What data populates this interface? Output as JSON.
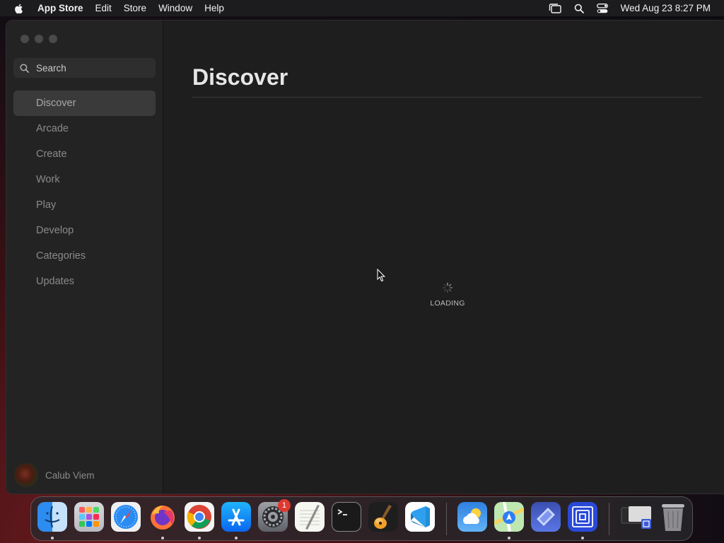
{
  "menubar": {
    "app_name": "App Store",
    "menus": [
      "Edit",
      "Store",
      "Window",
      "Help"
    ],
    "clock": "Wed Aug 23  8:27 PM"
  },
  "sidebar": {
    "search_placeholder": "Search",
    "items": [
      {
        "label": "Discover",
        "active": true
      },
      {
        "label": "Arcade"
      },
      {
        "label": "Create"
      },
      {
        "label": "Work"
      },
      {
        "label": "Play"
      },
      {
        "label": "Develop"
      },
      {
        "label": "Categories"
      },
      {
        "label": "Updates"
      }
    ],
    "user_name": "Calub Viem"
  },
  "main": {
    "title": "Discover",
    "loading_text": "LOADING"
  },
  "dock": {
    "apps": [
      {
        "name": "Finder",
        "icon": "finder-icon",
        "running": true
      },
      {
        "name": "Launchpad",
        "icon": "launchpad-icon"
      },
      {
        "name": "Safari",
        "icon": "safari-icon"
      },
      {
        "name": "Firefox",
        "icon": "firefox-icon",
        "running": true
      },
      {
        "name": "Chrome",
        "icon": "chrome-icon",
        "running": true
      },
      {
        "name": "App Store",
        "icon": "app-store-icon",
        "running": true
      },
      {
        "name": "System Settings",
        "icon": "system-settings-icon",
        "badge": "1"
      },
      {
        "name": "TextEdit",
        "icon": "textedit-icon"
      },
      {
        "name": "Terminal",
        "icon": "terminal-icon"
      },
      {
        "name": "GarageBand",
        "icon": "garageband-icon"
      },
      {
        "name": "VS Code",
        "icon": "vscode-icon"
      },
      {
        "name": "Weather",
        "icon": "weather-icon"
      },
      {
        "name": "Maps",
        "icon": "maps-icon",
        "running": true
      },
      {
        "name": "Nova",
        "icon": "nova-icon"
      },
      {
        "name": "Screen Sharing",
        "icon": "screen-sharing-icon",
        "running": true
      },
      {
        "name": "Downloads",
        "icon": "downloads-stack-icon"
      },
      {
        "name": "Trash",
        "icon": "trash-icon"
      }
    ]
  },
  "colors": {
    "window_bg": "#1e1e1e",
    "sidebar_bg": "#232323",
    "active_item_bg": "#3a3a3a",
    "badge_red": "#e0392f"
  }
}
